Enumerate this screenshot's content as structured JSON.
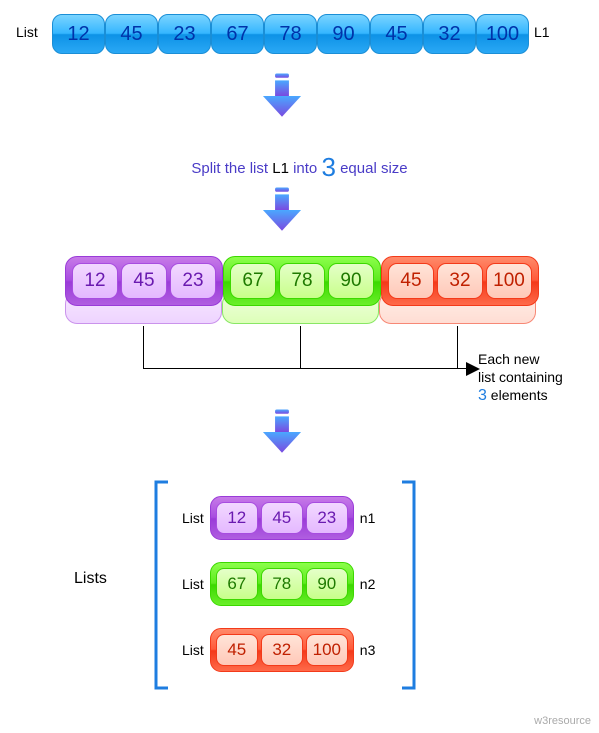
{
  "chart_data": {
    "type": "diagram",
    "original_list": [
      12,
      45,
      23,
      67,
      78,
      90,
      45,
      32,
      100
    ],
    "list_name": "L1",
    "split_into": 3,
    "groups": [
      {
        "name": "n1",
        "values": [
          12,
          45,
          23
        ],
        "color": "purple"
      },
      {
        "name": "n2",
        "values": [
          67,
          78,
          90
        ],
        "color": "green"
      },
      {
        "name": "n3",
        "values": [
          45,
          32,
          100
        ],
        "color": "red"
      }
    ],
    "each_containing": 3
  },
  "labels": {
    "list": "List",
    "l1": "L1",
    "split_prefix": "Split the list ",
    "split_mid": " into ",
    "split_suffix": " equal size",
    "each_l1": "Each new",
    "each_l2": "list containing",
    "each_l3_suffix": " elements",
    "lists": "Lists",
    "n1": "n1",
    "n2": "n2",
    "n3": "n3",
    "three": "3"
  },
  "cells": {
    "c0": "12",
    "c1": "45",
    "c2": "23",
    "c3": "67",
    "c4": "78",
    "c5": "90",
    "c6": "45",
    "c7": "32",
    "c8": "100"
  },
  "watermark": "w3resource"
}
